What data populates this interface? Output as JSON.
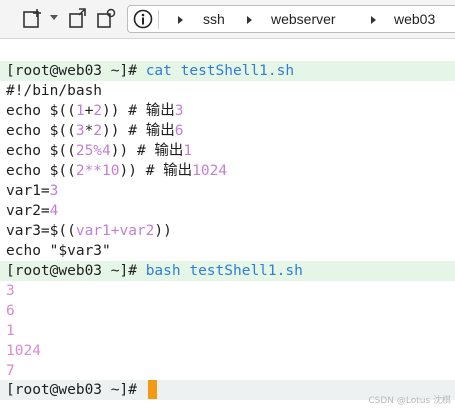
{
  "toolbar": {
    "breadcrumb": [
      "ssh",
      "webserver",
      "web03"
    ]
  },
  "terminal": {
    "prompt": "[root@web03 ~]# ",
    "cmd1": "cat testShell1.sh",
    "script": {
      "shebang": "#!/bin/bash",
      "l1": {
        "a": "echo $((",
        "n1": "1",
        "op": "+",
        "n2": "2",
        "b": ")) # 输出",
        "out": "3"
      },
      "l2": {
        "a": "echo $((",
        "n1": "3",
        "op": "*",
        "n2": "2",
        "b": ")) # 输出",
        "out": "6"
      },
      "l3": {
        "a": "echo $((",
        "n1": "25%4",
        "b": ")) # 输出",
        "out": "1"
      },
      "l4": {
        "a": "echo $((",
        "n1": "2**10",
        "b": ")) # 输出",
        "out": "1024"
      },
      "v1": {
        "a": "var1=",
        "n": "3"
      },
      "v2": {
        "a": "var2=",
        "n": "4"
      },
      "v3": {
        "a": "var3=$((",
        "n": "var1+var2",
        "b": "))"
      },
      "echo": "echo \"$var3\""
    },
    "cmd2": "bash testShell1.sh",
    "output": [
      "3",
      "6",
      "1",
      "1024",
      "7"
    ]
  },
  "watermark": "CSDN @Lotus 沈棋",
  "colors": {
    "command": "#2f7dd8",
    "number": "#c37fd6",
    "output": "#d98ad0",
    "prompt_bg": "#e6f6e6",
    "cursor": "#f29a14"
  }
}
